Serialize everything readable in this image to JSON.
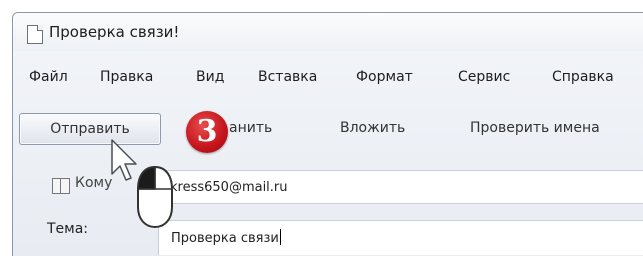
{
  "window": {
    "title": "Проверка связи!"
  },
  "menu": {
    "items": [
      {
        "label": "Файл"
      },
      {
        "label": "Правка"
      },
      {
        "label": "Вид"
      },
      {
        "label": "Вставка"
      },
      {
        "label": "Формат"
      },
      {
        "label": "Сервис"
      },
      {
        "label": "Справка"
      }
    ]
  },
  "toolbar": {
    "send_label": "Отправить",
    "save_label": "анить",
    "attach_label": "Вложить",
    "check_names_label": "Проверить имена"
  },
  "step_badge": "3",
  "fields": {
    "to_label": "Кому",
    "to_value": "kress650@mail.ru",
    "subject_label": "Тема:",
    "subject_value": "Проверка связи"
  },
  "colors": {
    "badge": "#c4141b",
    "window_bg": "#eef1f6",
    "field_border": "#c7ced8"
  },
  "icons": {
    "document": "document-icon",
    "address_book": "address-book-icon",
    "mouse": "mouse-left-click-icon",
    "cursor": "arrow-cursor-icon"
  }
}
